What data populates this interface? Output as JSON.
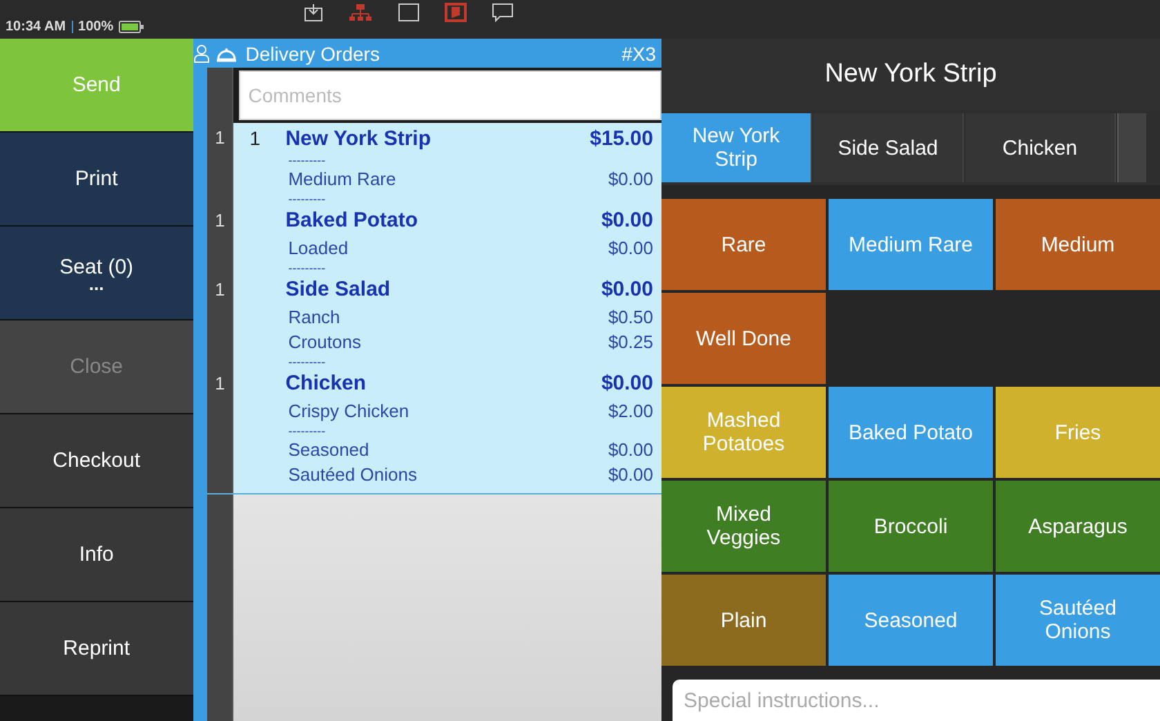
{
  "status_bar": {
    "time": "10:34 AM",
    "battery": "100%"
  },
  "actions": [
    {
      "label": "Send",
      "kind": "send",
      "disabled": false
    },
    {
      "label": "Print",
      "kind": "primary",
      "disabled": false
    },
    {
      "label": "Seat (0)",
      "kind": "seat",
      "more": "...",
      "disabled": false
    },
    {
      "label": "Close",
      "kind": "plain",
      "disabled": true
    },
    {
      "label": "Checkout",
      "kind": "plain",
      "disabled": false
    },
    {
      "label": "Info",
      "kind": "plain",
      "disabled": false
    },
    {
      "label": "Reprint",
      "kind": "plain",
      "disabled": false
    }
  ],
  "order": {
    "title": "Delivery Orders",
    "number": "#X3",
    "comments_placeholder": "Comments",
    "lines": [
      {
        "kind": "item",
        "seat": "1",
        "qty": "1",
        "name": "New York Strip",
        "price": "$15.00"
      },
      {
        "kind": "separator",
        "text": "---------"
      },
      {
        "kind": "modifier",
        "name": "Medium Rare",
        "price": "$0.00"
      },
      {
        "kind": "separator",
        "text": "---------"
      },
      {
        "kind": "item",
        "seat": "1",
        "name": "Baked Potato",
        "price": "$0.00"
      },
      {
        "kind": "modifier",
        "name": "Loaded",
        "price": "$0.00"
      },
      {
        "kind": "separator",
        "text": "---------"
      },
      {
        "kind": "item",
        "seat": "1",
        "name": "Side Salad",
        "price": "$0.00"
      },
      {
        "kind": "modifier",
        "name": "Ranch",
        "price": "$0.50"
      },
      {
        "kind": "modifier",
        "name": "Croutons",
        "price": "$0.25"
      },
      {
        "kind": "separator",
        "text": "---------"
      },
      {
        "kind": "item",
        "seat": "1",
        "name": "Chicken",
        "price": "$0.00"
      },
      {
        "kind": "modifier",
        "name": "Crispy Chicken",
        "price": "$2.00"
      },
      {
        "kind": "separator",
        "text": "---------"
      },
      {
        "kind": "modifier",
        "name": "Seasoned",
        "price": "$0.00"
      },
      {
        "kind": "modifier",
        "name": "Sautéed Onions",
        "price": "$0.00"
      }
    ]
  },
  "modifier_panel": {
    "title": "New York Strip",
    "tabs": [
      {
        "label": "New York Strip",
        "selected": true
      },
      {
        "label": "Side Salad",
        "selected": false
      },
      {
        "label": "Chicken",
        "selected": false
      }
    ],
    "rows": [
      [
        {
          "label": "Rare",
          "color": "#b65a1e"
        },
        {
          "label": "Medium Rare",
          "color": "#3a9fe2"
        },
        {
          "label": "Medium",
          "color": "#b65a1e"
        }
      ],
      [
        {
          "label": "Well Done",
          "color": "#b65a1e"
        }
      ],
      [
        {
          "label": "Mashed Potatoes",
          "color": "#d0b12e"
        },
        {
          "label": "Baked Potato",
          "color": "#3a9fe2"
        },
        {
          "label": "Fries",
          "color": "#d0b12e"
        }
      ],
      [
        {
          "label": "Mixed Veggies",
          "color": "#3f7e22"
        },
        {
          "label": "Broccoli",
          "color": "#3f7e22"
        },
        {
          "label": "Asparagus",
          "color": "#3f7e22"
        }
      ],
      [
        {
          "label": "Plain",
          "color": "#8c6a1e"
        },
        {
          "label": "Seasoned",
          "color": "#3a9fe2"
        },
        {
          "label": "Sautéed Onions",
          "color": "#3a9fe2"
        }
      ]
    ],
    "instructions_placeholder": "Special instructions..."
  }
}
